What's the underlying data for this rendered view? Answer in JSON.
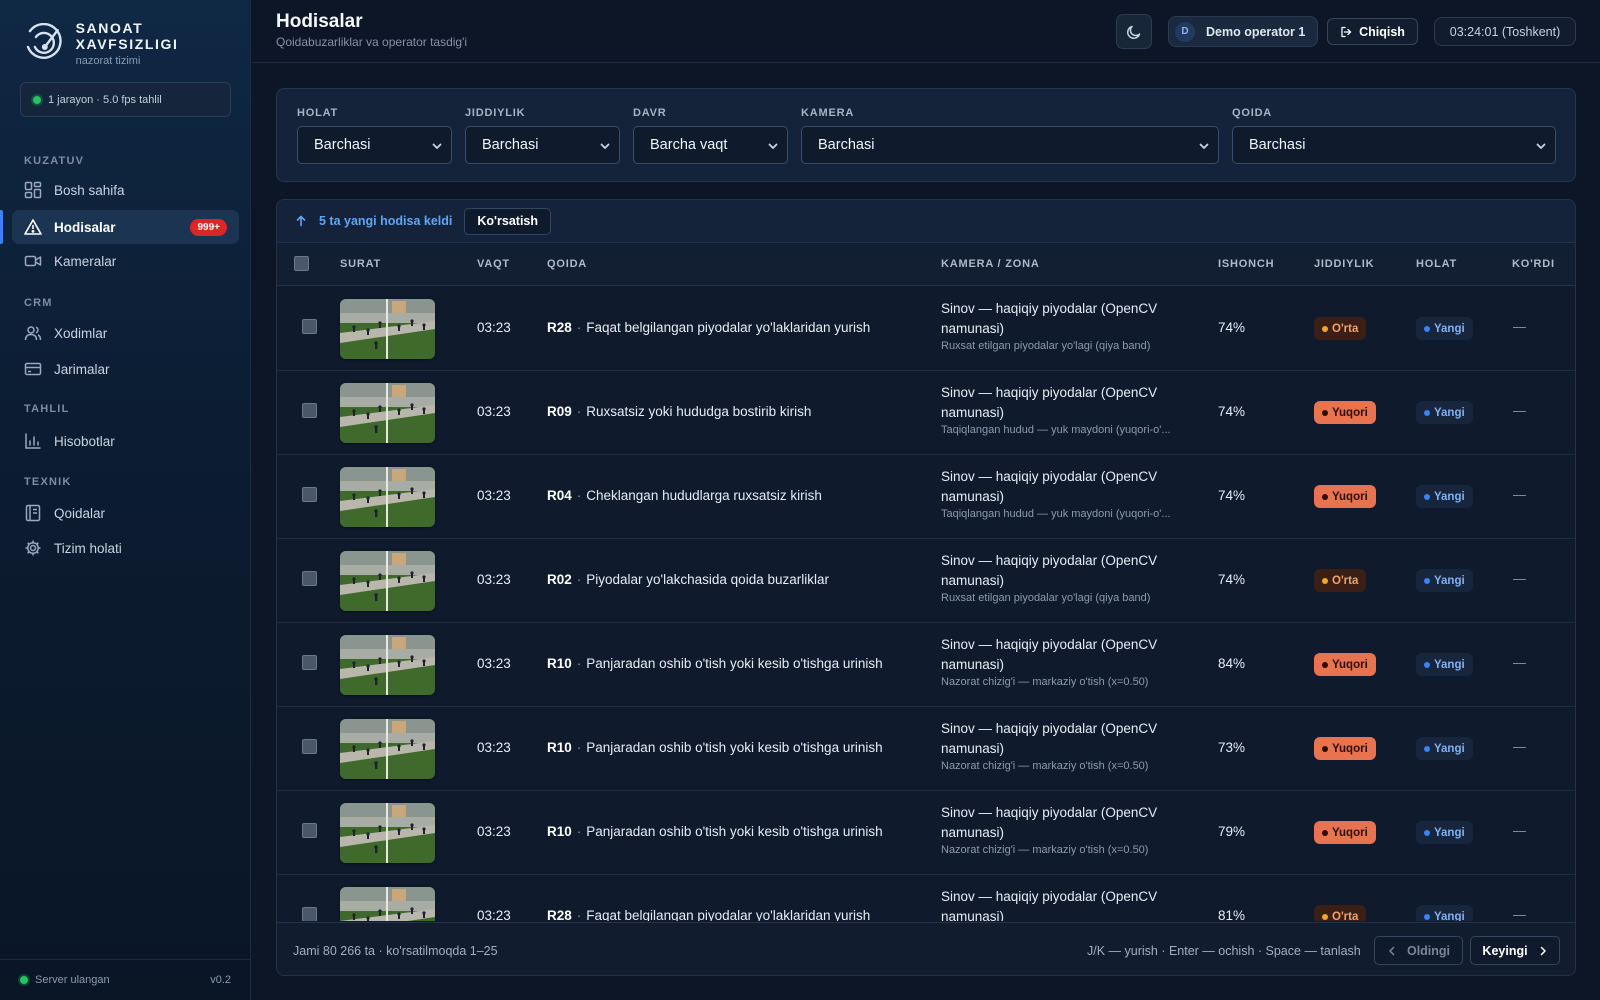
{
  "brand": {
    "title": "SANOAT XAVFSIZLIGI",
    "subtitle": "nazorat tizimi"
  },
  "stream_status": "1 jarayon · 5.0 fps tahlil",
  "sections": {
    "monitoring": "KUZATUV",
    "crm": "CRM",
    "analysis": "TAHLIL",
    "technical": "TEXNIK"
  },
  "nav": {
    "home": "Bosh sahifa",
    "incidents": "Hodisalar",
    "incidents_badge": "999+",
    "cameras": "Kameralar",
    "employees": "Xodimlar",
    "fines": "Jarimalar",
    "reports": "Hisobotlar",
    "rules": "Qoidalar",
    "system": "Tizim holati"
  },
  "footer": {
    "server": "Server ulangan",
    "version": "v0.2"
  },
  "header": {
    "title": "Hodisalar",
    "subtitle": "Qoidabuzarliklar va operator tasdig'i",
    "user_initial": "D",
    "user": "Demo operator 1",
    "logout": "Chiqish",
    "clock": "03:24:01 (Toshkent)"
  },
  "filters": {
    "status": {
      "label": "HOLAT",
      "value": "Barchasi"
    },
    "severity": {
      "label": "JIDDIYLIK",
      "value": "Barchasi"
    },
    "period": {
      "label": "DAVR",
      "value": "Barcha vaqt"
    },
    "camera": {
      "label": "KAMERA",
      "value": "Barchasi"
    },
    "rule": {
      "label": "QOIDA",
      "value": "Barchasi"
    }
  },
  "banner": {
    "text": "5 ta yangi hodisa keldi",
    "button": "Ko'rsatish"
  },
  "columns": {
    "image": "SURAT",
    "time": "VAQT",
    "rule": "QOIDA",
    "camera": "KAMERA / ZONA",
    "confidence": "ISHONCH",
    "severity": "JIDDIYLIK",
    "status": "HOLAT",
    "viewed": "KO'RDI"
  },
  "rows": [
    {
      "time": "03:23",
      "code": "R28",
      "rule": "Faqat belgilangan piyodalar yo'laklaridan yurish",
      "camera": "Sinov — haqiqiy piyodalar (OpenCV namunasi)",
      "zone": "Ruxsat etilgan piyodalar yo'lagi (qiya band)",
      "confidence": "74%",
      "severity": "O'rta",
      "severity_level": "mid",
      "status": "Yangi",
      "viewed": "—"
    },
    {
      "time": "03:23",
      "code": "R09",
      "rule": "Ruxsatsiz yoki hududga bostirib kirish",
      "camera": "Sinov — haqiqiy piyodalar (OpenCV namunasi)",
      "zone": "Taqiqlangan hudud — yuk maydoni (yuqori-o'...",
      "confidence": "74%",
      "severity": "Yuqori",
      "severity_level": "high",
      "status": "Yangi",
      "viewed": "—"
    },
    {
      "time": "03:23",
      "code": "R04",
      "rule": "Cheklangan hududlarga ruxsatsiz kirish",
      "camera": "Sinov — haqiqiy piyodalar (OpenCV namunasi)",
      "zone": "Taqiqlangan hudud — yuk maydoni (yuqori-o'...",
      "confidence": "74%",
      "severity": "Yuqori",
      "severity_level": "high",
      "status": "Yangi",
      "viewed": "—"
    },
    {
      "time": "03:23",
      "code": "R02",
      "rule": "Piyodalar yo'lakchasida qoida buzarliklar",
      "camera": "Sinov — haqiqiy piyodalar (OpenCV namunasi)",
      "zone": "Ruxsat etilgan piyodalar yo'lagi (qiya band)",
      "confidence": "74%",
      "severity": "O'rta",
      "severity_level": "mid",
      "status": "Yangi",
      "viewed": "—"
    },
    {
      "time": "03:23",
      "code": "R10",
      "rule": "Panjaradan oshib o'tish yoki kesib o'tishga urinish",
      "camera": "Sinov — haqiqiy piyodalar (OpenCV namunasi)",
      "zone": "Nazorat chizig'i — markaziy o'tish (x=0.50)",
      "confidence": "84%",
      "severity": "Yuqori",
      "severity_level": "high",
      "status": "Yangi",
      "viewed": "—"
    },
    {
      "time": "03:23",
      "code": "R10",
      "rule": "Panjaradan oshib o'tish yoki kesib o'tishga urinish",
      "camera": "Sinov — haqiqiy piyodalar (OpenCV namunasi)",
      "zone": "Nazorat chizig'i — markaziy o'tish (x=0.50)",
      "confidence": "73%",
      "severity": "Yuqori",
      "severity_level": "high",
      "status": "Yangi",
      "viewed": "—"
    },
    {
      "time": "03:23",
      "code": "R10",
      "rule": "Panjaradan oshib o'tish yoki kesib o'tishga urinish",
      "camera": "Sinov — haqiqiy piyodalar (OpenCV namunasi)",
      "zone": "Nazorat chizig'i — markaziy o'tish (x=0.50)",
      "confidence": "79%",
      "severity": "Yuqori",
      "severity_level": "high",
      "status": "Yangi",
      "viewed": "—"
    },
    {
      "time": "03:23",
      "code": "R28",
      "rule": "Faqat belgilangan piyodalar yo'laklaridan yurish",
      "camera": "Sinov — haqiqiy piyodalar (OpenCV namunasi)",
      "zone": "",
      "confidence": "81%",
      "severity": "O'rta",
      "severity_level": "mid",
      "status": "Yangi",
      "viewed": "—"
    }
  ],
  "pagination": {
    "total": "Jami 80 266 ta · ko'rsatilmoqda 1–25",
    "hint": "J/K — yurish · Enter — ochish · Space — tanlash",
    "prev": "Oldingi",
    "next": "Keyingi"
  },
  "colors": {
    "accent": "#3b82f6",
    "danger_badge": "#dc2626",
    "severity_high": "#e8734f",
    "severity_mid": "#f5a524",
    "online": "#22c55e"
  }
}
